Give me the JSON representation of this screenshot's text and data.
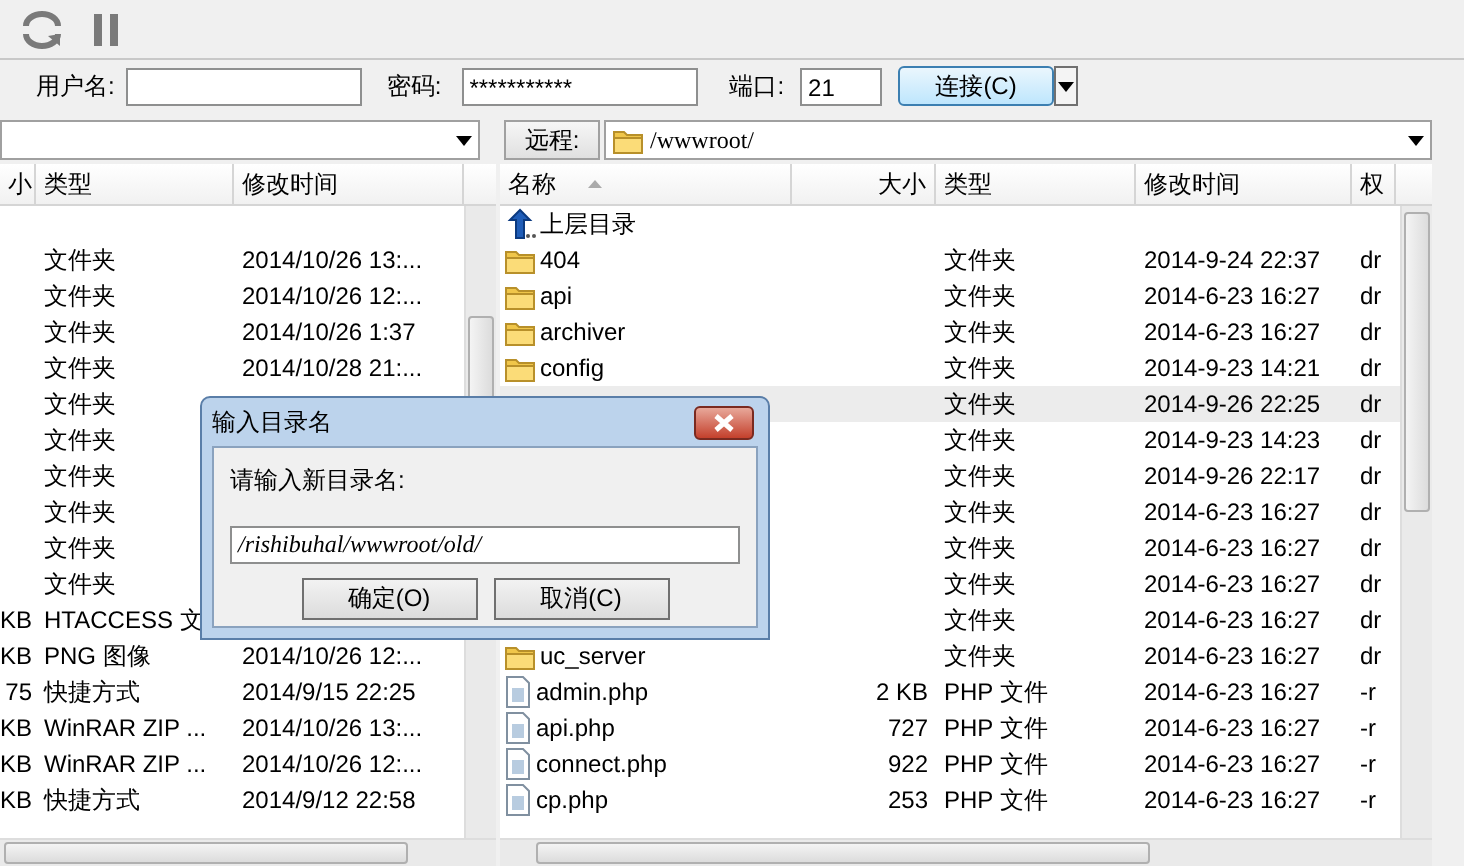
{
  "connection": {
    "username_label": "用户名:",
    "password_label": "密码:",
    "password_value": "***********",
    "port_label": "端口:",
    "port_value": "21",
    "connect_button": "连接(C)"
  },
  "local_pane": {
    "columns": [
      "小",
      "类型",
      "修改时间"
    ],
    "rows": [
      {
        "type": "文件夹",
        "modified": "2014/10/26 13:..."
      },
      {
        "type": "文件夹",
        "modified": "2014/10/26 12:..."
      },
      {
        "type": "文件夹",
        "modified": "2014/10/26 1:37"
      },
      {
        "type": "文件夹",
        "modified": "2014/10/28 21:..."
      },
      {
        "type": "文件夹"
      },
      {
        "type": "文件夹"
      },
      {
        "type": "文件夹"
      },
      {
        "type": "文件夹"
      },
      {
        "type": "文件夹"
      },
      {
        "type": "文件夹"
      },
      {
        "size": "KB",
        "type": "HTACCESS 文"
      },
      {
        "size": "KB",
        "type": "PNG 图像",
        "modified": "2014/10/26 12:..."
      },
      {
        "size": "75",
        "type": "快捷方式",
        "modified": "2014/9/15 22:25"
      },
      {
        "size": "KB",
        "type": "WinRAR ZIP ...",
        "modified": "2014/10/26 13:..."
      },
      {
        "size": "KB",
        "type": "WinRAR ZIP ...",
        "modified": "2014/10/26 12:..."
      },
      {
        "size": "KB",
        "type": "快捷方式",
        "modified": "2014/9/12 22:58"
      }
    ]
  },
  "remote_pane": {
    "label": "远程:",
    "path": "/wwwroot/",
    "columns": [
      "名称",
      "大小",
      "类型",
      "修改时间",
      "权"
    ],
    "rows": [
      {
        "kind": "parent",
        "name": "上层目录",
        "selected": false
      },
      {
        "kind": "folder",
        "name": "404",
        "type": "文件夹",
        "modified": "2014-9-24 22:37",
        "perms": "dr",
        "selected": false
      },
      {
        "kind": "folder",
        "name": "api",
        "type": "文件夹",
        "modified": "2014-6-23 16:27",
        "perms": "dr",
        "selected": false
      },
      {
        "kind": "folder",
        "name": "archiver",
        "type": "文件夹",
        "modified": "2014-6-23 16:27",
        "perms": "dr",
        "selected": false
      },
      {
        "kind": "folder",
        "name": "config",
        "type": "文件夹",
        "modified": "2014-9-23 14:21",
        "perms": "dr",
        "selected": false
      },
      {
        "kind": "folder",
        "type": "文件夹",
        "modified": "2014-9-26 22:25",
        "perms": "dr",
        "selected": true
      },
      {
        "kind": "folder",
        "type": "文件夹",
        "modified": "2014-9-23 14:23",
        "perms": "dr",
        "selected": false
      },
      {
        "kind": "folder",
        "type": "文件夹",
        "modified": "2014-9-26 22:17",
        "perms": "dr",
        "selected": false
      },
      {
        "kind": "folder",
        "type": "文件夹",
        "modified": "2014-6-23 16:27",
        "perms": "dr",
        "selected": false
      },
      {
        "kind": "folder",
        "type": "文件夹",
        "modified": "2014-6-23 16:27",
        "perms": "dr",
        "selected": false
      },
      {
        "kind": "folder",
        "type": "文件夹",
        "modified": "2014-6-23 16:27",
        "perms": "dr",
        "selected": false
      },
      {
        "kind": "folder",
        "type": "文件夹",
        "modified": "2014-6-23 16:27",
        "perms": "dr",
        "selected": false
      },
      {
        "kind": "folder",
        "name": "uc_server",
        "type": "文件夹",
        "modified": "2014-6-23 16:27",
        "perms": "dr",
        "selected": false
      },
      {
        "kind": "file",
        "name": "admin.php",
        "size": "2 KB",
        "type": "PHP 文件",
        "modified": "2014-6-23 16:27",
        "perms": "-r",
        "selected": false
      },
      {
        "kind": "file",
        "name": "api.php",
        "size": "727",
        "type": "PHP 文件",
        "modified": "2014-6-23 16:27",
        "perms": "-r",
        "selected": false
      },
      {
        "kind": "file",
        "name": "connect.php",
        "size": "922",
        "type": "PHP 文件",
        "modified": "2014-6-23 16:27",
        "perms": "-r",
        "selected": false
      },
      {
        "kind": "file",
        "name": "cp.php",
        "size": "253",
        "type": "PHP 文件",
        "modified": "2014-6-23 16:27",
        "perms": "-r",
        "selected": false
      }
    ]
  },
  "dialog": {
    "title": "输入目录名",
    "prompt": "请输入新目录名:",
    "value": "/rishibuhal/wwwroot/old/",
    "ok_button": "确定(O)",
    "cancel_button": "取消(C)"
  }
}
